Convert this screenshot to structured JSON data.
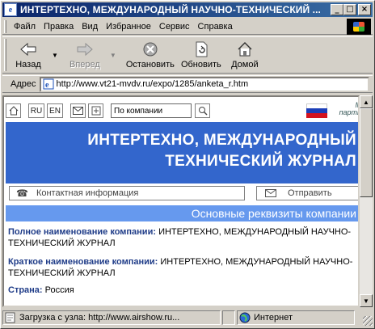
{
  "window": {
    "title": "ИНТЕРТЕХНО, МЕЖДУНАРОДНЫЙ НАУЧНО-ТЕХНИЧЕСКИЙ ...",
    "icon": "ie-page-icon",
    "controls": {
      "minimize": "_",
      "maximize": "□",
      "close": "×"
    }
  },
  "menu": {
    "items": [
      {
        "label": "Файл"
      },
      {
        "label": "Правка"
      },
      {
        "label": "Вид"
      },
      {
        "label": "Избранное"
      },
      {
        "label": "Сервис"
      },
      {
        "label": "Справка"
      }
    ]
  },
  "toolbar": {
    "back": "Назад",
    "forward": "Вперед",
    "stop": "Остановить",
    "refresh": "Обновить",
    "home": "Домой"
  },
  "address": {
    "label": "Адрес",
    "url": "http://www.vt21-mvdv.ru/expo/1285/anketa_r.htm"
  },
  "site": {
    "lang_ru": "RU",
    "lang_en": "EN",
    "search_placeholder": "По компании",
    "partner_note": "М\nпартн",
    "banner_line1": "ИНТЕРТЕХНО, МЕЖДУНАРОДНЫЙ",
    "banner_line2": "ТЕХНИЧЕСКИЙ ЖУРНАЛ",
    "contact_label": "Контактная информация",
    "send_label": "Отправить",
    "section_title": "Основные реквизиты компании",
    "fields": [
      {
        "key": "Полное наименование компании:",
        "value": "ИНТЕРТЕХНО, МЕЖДУНАРОДНЫЙ НАУЧНО-ТЕХНИЧЕСКИЙ ЖУРНАЛ"
      },
      {
        "key": "Краткое наименование компании:",
        "value": "ИНТЕРТЕХНО, МЕЖДУНАРОДНЫЙ НАУЧНО-ТЕХНИЧЕСКИЙ ЖУРНАЛ"
      },
      {
        "key": "Страна:",
        "value": "Россия"
      }
    ]
  },
  "status": {
    "text": "Загрузка с узла: http://www.airshow.ru...",
    "zone": "Интернет"
  },
  "colors": {
    "title_bar": "#0a246a",
    "banner": "#3366cc",
    "section_bar": "#6699ee",
    "field_key": "#1f3c88"
  }
}
